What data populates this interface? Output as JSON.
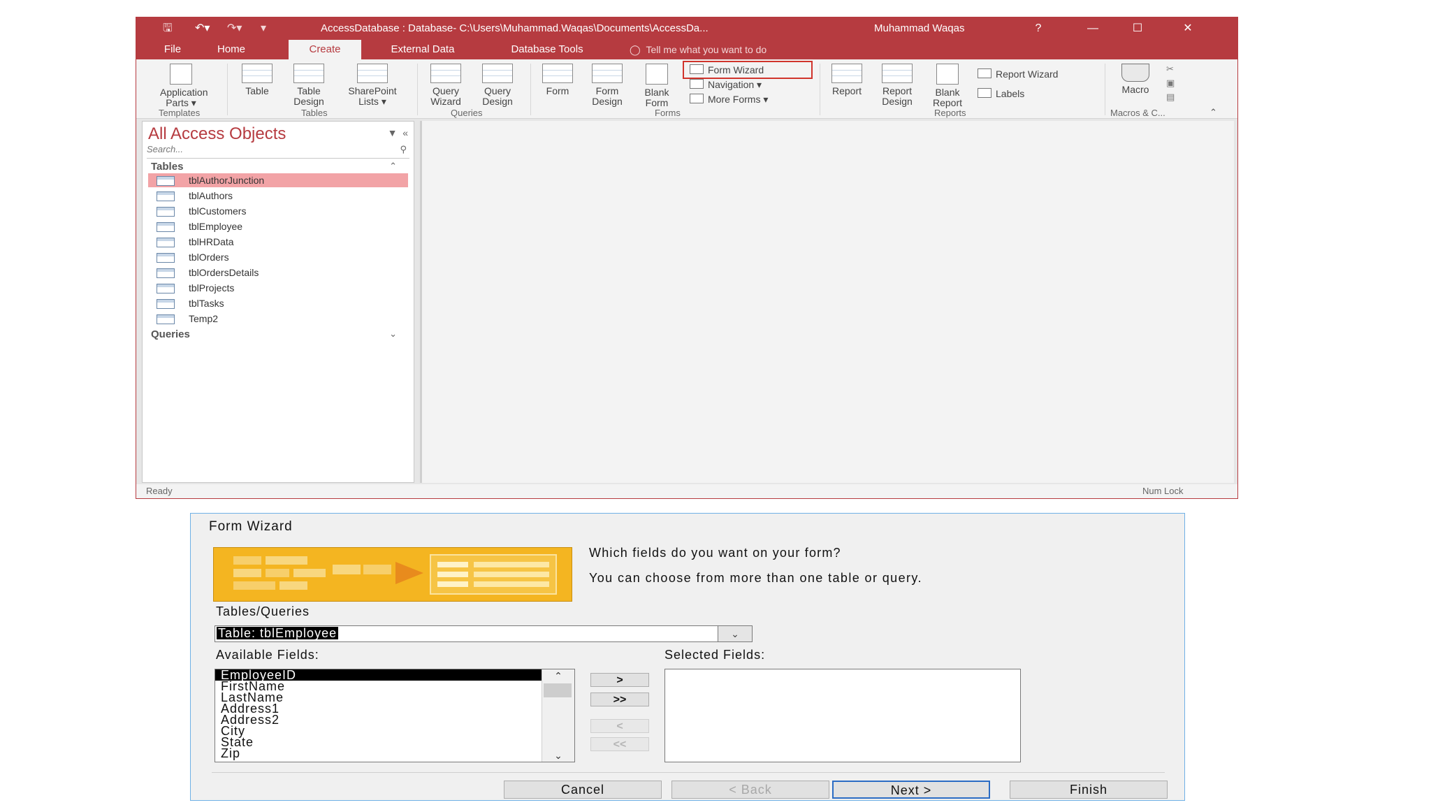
{
  "access": {
    "title": "AccessDatabase : Database- C:\\Users\\Muhammad.Waqas\\Documents\\AccessDa...",
    "user": "Muhammad Waqas",
    "help": "?",
    "tabs": [
      "File",
      "Home",
      "Create",
      "External Data",
      "Database Tools"
    ],
    "active_tab": "Create",
    "tell_me": "Tell me what you want to do",
    "ribbon": {
      "application_parts": "Application Parts ▾",
      "table": "Table",
      "table_design": "Table Design",
      "sharepoint_lists": "SharePoint Lists ▾",
      "query_wizard": "Query Wizard",
      "query_design": "Query Design",
      "form": "Form",
      "form_design": "Form Design",
      "blank_form": "Blank Form",
      "form_wizard": "Form Wizard",
      "navigation": "Navigation ▾",
      "more_forms": "More Forms ▾",
      "report": "Report",
      "report_design": "Report Design",
      "blank_report": "Blank Report",
      "report_wizard": "Report Wizard",
      "labels": "Labels",
      "macro": "Macro",
      "groups": [
        "Templates",
        "Tables",
        "Queries",
        "Forms",
        "Reports",
        "Macros & C..."
      ]
    },
    "nav": {
      "title": "All Access Objects",
      "search_placeholder": "Search...",
      "tables_header": "Tables",
      "queries_header": "Queries",
      "tables": [
        "tblAuthorJunction",
        "tblAuthors",
        "tblCustomers",
        "tblEmployee",
        "tblHRData",
        "tblOrders",
        "tblOrdersDetails",
        "tblProjects",
        "tblTasks",
        "Temp2"
      ],
      "selected": "tblAuthorJunction"
    },
    "status_left": "Ready",
    "status_right": "Num Lock"
  },
  "wizard": {
    "title": "Form Wizard",
    "question1": "Which fields do you want on your form?",
    "question2": "You can choose from more than one table or query.",
    "tables_label": "Tables/Queries",
    "tables_value": "Table: tblEmployee",
    "available_label": "Available Fields:",
    "selected_label": "Selected Fields:",
    "available_fields": [
      "EmployeeID",
      "FirstName",
      "LastName",
      "Address1",
      "Address2",
      "City",
      "State",
      "Zip"
    ],
    "move_one": ">",
    "move_all": ">>",
    "remove_one": "<",
    "remove_all": "<<",
    "cancel": "Cancel",
    "back": "< Back",
    "next": "Next >",
    "finish": "Finish"
  }
}
